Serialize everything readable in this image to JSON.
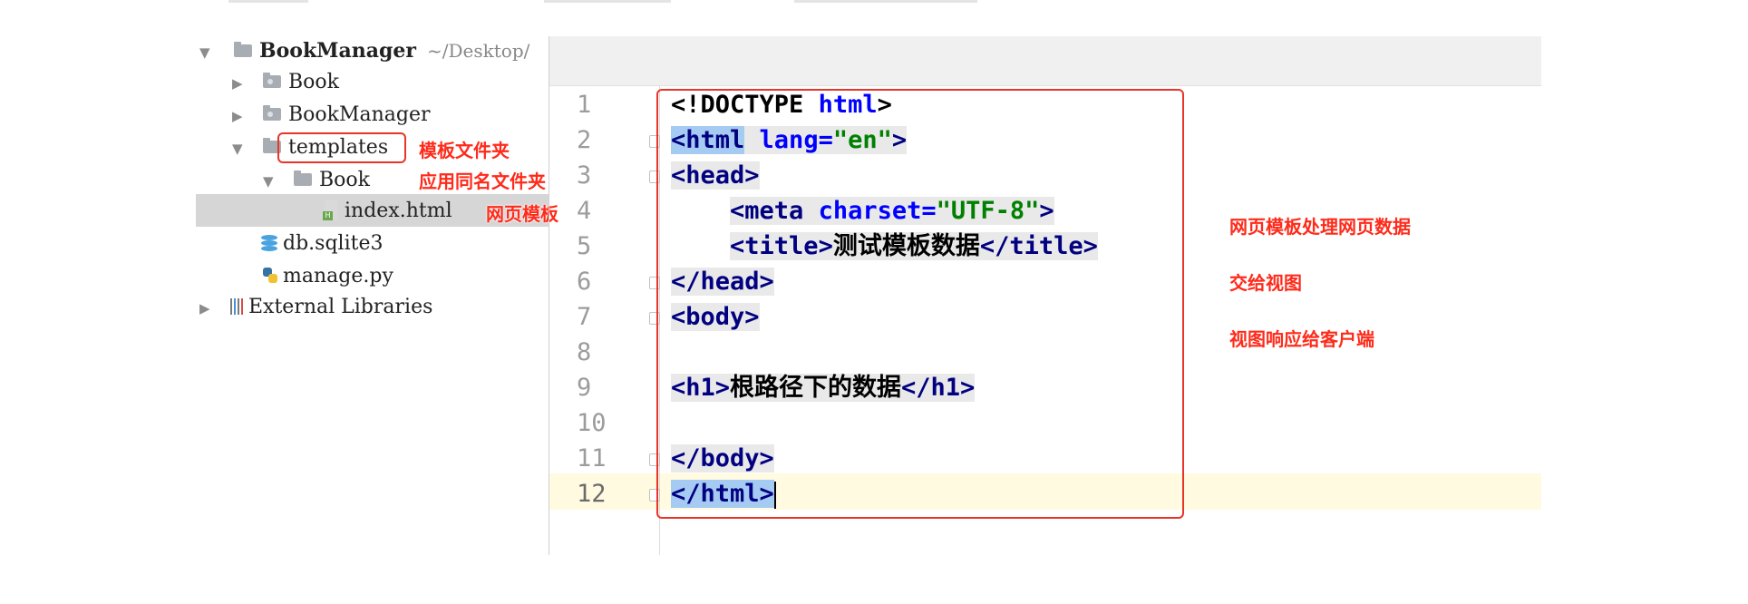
{
  "project_tree": {
    "root": {
      "name": "BookManager",
      "path": "~/Desktop/"
    },
    "items": [
      {
        "label": "Book"
      },
      {
        "label": "BookManager"
      },
      {
        "label": "templates"
      },
      {
        "label": "Book"
      },
      {
        "label": "index.html"
      },
      {
        "label": "db.sqlite3"
      },
      {
        "label": "manage.py"
      },
      {
        "label": "External Libraries"
      }
    ]
  },
  "annotations": {
    "templates_note": "模板文件夹",
    "app_folder_note": "应用同名文件夹",
    "template_file_note": "网页模板",
    "flow": [
      "网页模板处理网页数据",
      "交给视图",
      "视图响应给客户端"
    ]
  },
  "editor": {
    "line_numbers": [
      "1",
      "2",
      "3",
      "4",
      "5",
      "6",
      "7",
      "8",
      "9",
      "10",
      "11",
      "12"
    ],
    "current_line": "12",
    "code": {
      "l1_open": "<!DOCTYPE ",
      "l1_kw": "html",
      "l1_close": ">",
      "l2_tag": "<html",
      "l2_attr": "lang=",
      "l2_val": "\"en\"",
      "l2_close": ">",
      "l3": "<head>",
      "l4_tag": "<meta",
      "l4_attr": "charset=",
      "l4_val": "\"UTF-8\"",
      "l4_close": ">",
      "l5_open": "<title>",
      "l5_text": "测试模板数据",
      "l5_close": "</title>",
      "l6": "</head>",
      "l7": "<body>",
      "l9_open": "<h1>",
      "l9_text": "根路径下的数据",
      "l9_close": "</h1>",
      "l11": "</body>",
      "l12": "</html>"
    }
  }
}
